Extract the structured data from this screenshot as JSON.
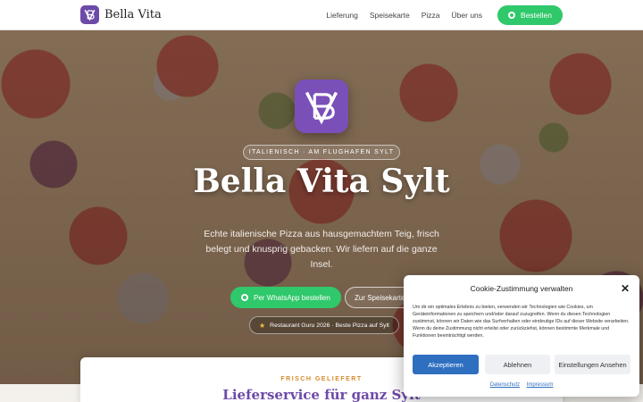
{
  "header": {
    "brand_name": "Bella Vita",
    "nav": [
      "Lieferung",
      "Speisekarte",
      "Pizza",
      "Über uns"
    ],
    "cta_label": "Bestellen"
  },
  "hero": {
    "tagline": "ITALIENISCH · AM FLUGHAFEN SYLT",
    "title": "Bella Vita Sylt",
    "description": "Echte italienische Pizza aus hausgemachtem Teig, frisch belegt und knusprig gebacken. Wir liefern auf die ganze Insel.",
    "whatsapp_label": "Per WhatsApp bestellen",
    "menu_label": "Zur Speisekarte",
    "award_label": "Restaurant Guru 2026 · Beste Pizza auf Sylt"
  },
  "delivery": {
    "eyebrow": "FRISCH GELIEFERT",
    "title": "Lieferservice für ganz Sylt"
  },
  "cookie": {
    "title": "Cookie-Zustimmung verwalten",
    "text": "Um dir ein optimales Erlebnis zu bieten, verwenden wir Technologien wie Cookies, um Geräteinformationen zu speichern und/oder darauf zuzugreifen. Wenn du diesen Technologien zustimmst, können wir Daten wie das Surfverhalten oder eindeutige IDs auf dieser Website verarbeiten. Wenn du deine Zustimmung nicht erteilst oder zurückziehst, können bestimmte Merkmale und Funktionen beeinträchtigt werden.",
    "accept_label": "Akzeptieren",
    "decline_label": "Ablehnen",
    "settings_label": "Einstellungen Ansehen",
    "privacy_label": "Datenschutz",
    "imprint_label": "Impressum"
  },
  "colors": {
    "brand_purple": "#6d4aa8",
    "whatsapp_green": "#2fc86a",
    "accept_blue": "#2f6fc0",
    "accent_orange": "#d88a2a"
  },
  "icons": {
    "logo": "bv-monogram-icon",
    "whatsapp": "whatsapp-icon",
    "award": "star-icon",
    "close": "close-icon"
  }
}
